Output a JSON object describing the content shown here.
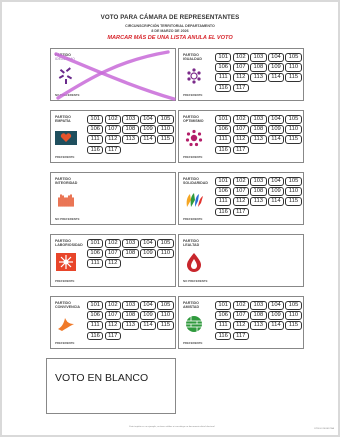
{
  "header": {
    "title": "VOTO PARA CÁMARA DE REPRESENTANTES",
    "constituency": "CIRCUNSCRIPCIÓN TERRITORIAL DEPARTAMENTO",
    "date": "8 DE MARZO DE 2026",
    "warning": "MARCAR MÁS DE UNA LISTA ANULA EL VOTO"
  },
  "labels": {
    "party": "PARTIDO",
    "preferente": "PREFERENTE",
    "no_preferente": "NO PREFERENTE"
  },
  "numbers": [
    "101",
    "102",
    "103",
    "104",
    "105",
    "106",
    "107",
    "108",
    "109",
    "110",
    "111",
    "112",
    "113",
    "114",
    "115",
    "116",
    "117"
  ],
  "parties": [
    {
      "name": "IDEALISMO",
      "list_count": 0,
      "pref": "NO PREFERENTE",
      "logo": "sprout-icon",
      "color": "#6a2a8c"
    },
    {
      "name": "IGUALDAD",
      "list_count": 17,
      "pref": "PREFERENTE",
      "logo": "people-ring-icon",
      "color": "#7b2a8a"
    },
    {
      "name": "EMPATÍA",
      "list_count": 17,
      "pref": "PREFERENTE",
      "logo": "heart-flag-icon",
      "color": "#1f4f5e"
    },
    {
      "name": "OPTIMISMO",
      "list_count": 17,
      "pref": "PREFERENTE",
      "logo": "sun-flower-icon",
      "color": "#b41f6a"
    },
    {
      "name": "INTEGRIDAD",
      "list_count": 0,
      "pref": "NO PREFERENTE",
      "logo": "hands-icon",
      "color": "#e5532b"
    },
    {
      "name": "SOLIDARIDAD",
      "list_count": 17,
      "pref": "PREFERENTE",
      "logo": "hands-fan-icon",
      "color": "#e3332d"
    },
    {
      "name": "LABORIOSIDAD",
      "list_count": 12,
      "pref": "PREFERENTE",
      "logo": "star-burst-icon",
      "color": "#e8452a"
    },
    {
      "name": "LEALTAD",
      "list_count": 0,
      "pref": "NO PREFERENTE",
      "logo": "flame-drop-icon",
      "color": "#c8262c"
    },
    {
      "name": "CONVIVENCIA",
      "list_count": 17,
      "pref": "PREFERENTE",
      "logo": "dove-icon",
      "color": "#f07a2a"
    },
    {
      "name": "AMISTAD",
      "list_count": 17,
      "pref": "PREFERENTE",
      "logo": "brick-globe-icon",
      "color": "#2f9a3d"
    }
  ],
  "blank_vote": "VOTO EN BLANCO",
  "footer": {
    "left": "Este tarjetón es un ejemplo, no tiene validez ni constituye un documento oficial electoral",
    "right": "CÓDIGO MUESTRA"
  }
}
